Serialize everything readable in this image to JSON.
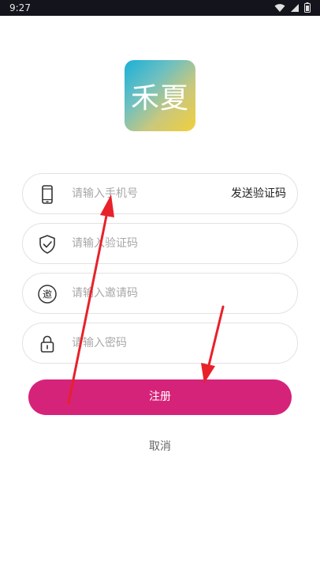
{
  "status_bar": {
    "time": "9:27",
    "icons": [
      "wifi-icon",
      "signal-icon",
      "battery-icon"
    ]
  },
  "logo": {
    "text": "禾夏"
  },
  "form": {
    "phone": {
      "placeholder": "请输入手机号",
      "value": "",
      "icon": "phone-icon",
      "send_code_label": "发送验证码"
    },
    "code": {
      "placeholder": "请输入验证码",
      "value": "",
      "icon": "shield-check-icon"
    },
    "invite": {
      "placeholder": "请输入邀请码",
      "value": "",
      "icon": "invite-badge-icon",
      "icon_glyph": "邀"
    },
    "password": {
      "placeholder": "请输入密码",
      "value": "",
      "icon": "lock-icon"
    }
  },
  "actions": {
    "register_label": "注册",
    "cancel_label": "取消"
  },
  "colors": {
    "primary": "#d5237a",
    "annotation_arrow": "#e8212a",
    "status_bar_bg": "#14141c"
  }
}
